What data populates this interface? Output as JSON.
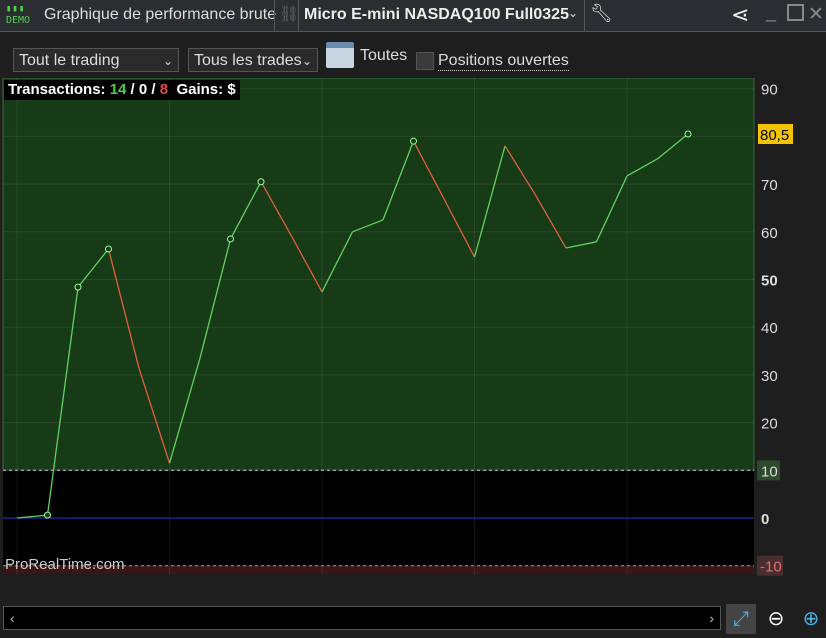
{
  "titlebar": {
    "demo_badge": "DEMO",
    "title": "Graphique de performance brute",
    "instrument": "Micro E-mini NASDAQ100 Full0325"
  },
  "toolbar": {
    "scope_select": "Tout le trading",
    "trades_select": "Tous les trades",
    "period_label": "Toutes",
    "open_positions_label": "Positions ouvertes",
    "open_positions_checked": false
  },
  "stats": {
    "label": "Transactions:",
    "wins": "14",
    "neutral": "0",
    "losses": "8",
    "gains_label": "Gains:",
    "gains_unit": "$"
  },
  "watermark": "ProRealTime.com",
  "colors": {
    "up": "#5fd35f",
    "down": "#e0603c",
    "zone_profit": "#173a17",
    "zone_loss": "#3a1515"
  },
  "chart_data": {
    "type": "line",
    "x": [
      0,
      1,
      2,
      3,
      4,
      5,
      6,
      7,
      8,
      9,
      10,
      11,
      12,
      13,
      14,
      15,
      16,
      17,
      18,
      19,
      20,
      21,
      22
    ],
    "values": [
      0,
      0.6,
      48.4,
      56.4,
      31.4,
      11.5,
      33.5,
      58.5,
      70.5,
      59.1,
      47.4,
      60,
      62.5,
      79,
      66.9,
      54.7,
      78,
      67.7,
      56.6,
      57.9,
      71.7,
      75.3,
      80.5
    ],
    "markers": [
      1,
      2,
      3,
      7,
      8,
      13,
      22
    ],
    "xticks": [
      "0",
      "5",
      "10",
      "15",
      "20"
    ],
    "yticks": [
      "90",
      "80",
      "70",
      "60",
      "50",
      "40",
      "30",
      "20",
      "10",
      "0",
      "-10"
    ],
    "ylim": [
      -12,
      92
    ],
    "xlim": [
      0,
      24.5
    ],
    "last_value_label": "80,5",
    "upper_threshold": 10,
    "lower_threshold": -10,
    "baseline": 0
  }
}
